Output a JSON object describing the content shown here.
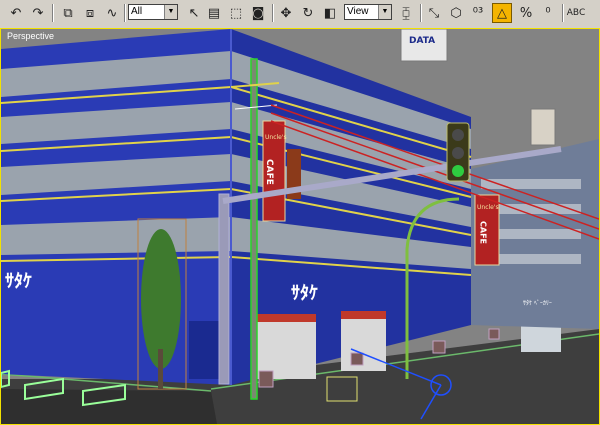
{
  "toolbar": {
    "selection_filter": "All",
    "reference_coord": "View",
    "icons": [
      "undo-icon",
      "redo-icon",
      "select-link-icon",
      "unlink-icon",
      "bind-space-warp-icon",
      "select-object-icon",
      "select-by-name-icon",
      "rectangular-region-icon",
      "window-crossing-icon",
      "move-icon",
      "rotate-icon",
      "scale-icon",
      "pivot-center-icon",
      "mirror-icon",
      "align-icon",
      "snap-3d-icon",
      "angle-snap-icon",
      "percent-snap-icon",
      "spinner-snap-icon",
      "named-selection-icon"
    ]
  },
  "viewport": {
    "label": "Perspective",
    "border_color": "#f2e200",
    "background": "#838383"
  },
  "scene": {
    "building_color": "#2a3bb5",
    "building_logo": "ｻﾀｹ",
    "building_logo_2": "ｻﾀｹ",
    "cafe_sign_top": "Uncle's",
    "cafe_sign_main": "CAFE",
    "cafe_sign_2_top": "Uncle's",
    "cafe_sign_2_main": "CAFE",
    "rooftop_sign": "DATA",
    "shop_sign": "ｻﾀｹ ﾍﾞｰｶﾘｰ"
  }
}
